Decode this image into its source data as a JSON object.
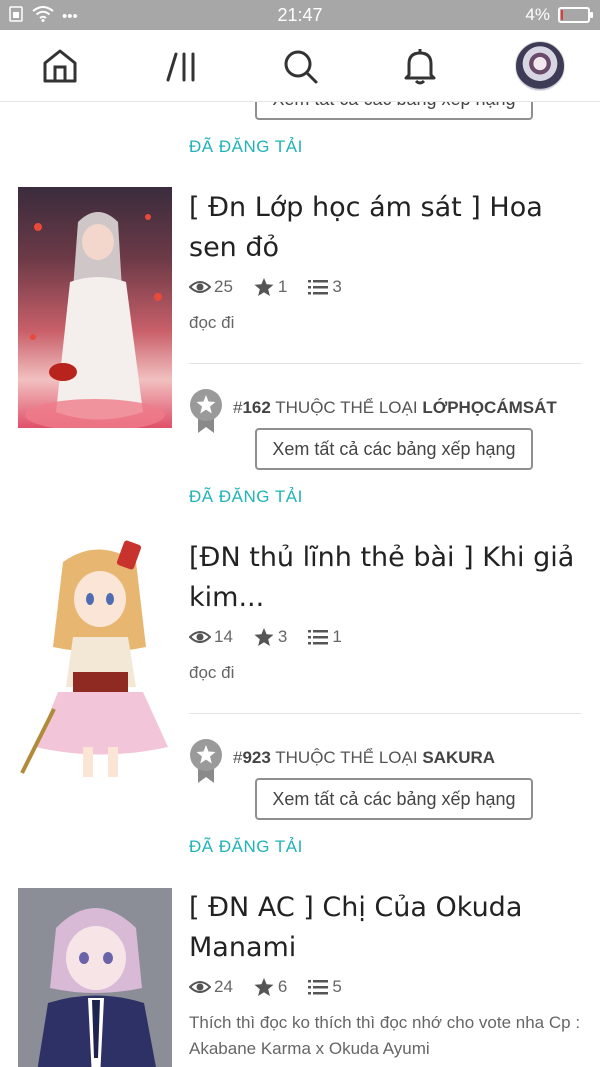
{
  "status_bar": {
    "time": "21:47",
    "battery_text": "4%",
    "battery_level_percent": 4,
    "signal_glyph": "⚀",
    "more_glyph": "•••"
  },
  "nav": {
    "home_icon": "home-icon",
    "library_icon": "library-icon",
    "search_icon": "search-icon",
    "notifications_icon": "bell-icon"
  },
  "feed": {
    "top_partial_button": "Xem tất cả các bảng xếp hạng",
    "posted_label": "ĐÃ ĐĂNG TẢI",
    "see_all_label": "Xem tất cả các bảng xếp hạng",
    "rank_prefix": "#",
    "rank_middle": "THUỘC THỂ LOẠI",
    "stories": [
      {
        "title": "[ Đn Lớp học ám sát ] Hoa sen đỏ",
        "reads": "25",
        "votes": "1",
        "parts": "3",
        "description": "đọc đi",
        "rank": "162",
        "category": "LỚPHỌCÁMSÁT"
      },
      {
        "title": "[ĐN thủ lĩnh thẻ bài ] Khi giả kim...",
        "reads": "14",
        "votes": "3",
        "parts": "1",
        "description": "đọc đi",
        "rank": "923",
        "category": "SAKURA"
      },
      {
        "title": "[ ĐN AC ] Chị Của Okuda Manami",
        "reads": "24",
        "votes": "6",
        "parts": "5",
        "description": "Thích thì đọc ko thích thì đọc nhớ cho vote nha Cp : Akabane Karma x Okuda Ayumi"
      }
    ]
  },
  "colors": {
    "accent_teal": "#21b3b9",
    "status_bar": "#a7a7a7",
    "battery_low": "#e53935"
  }
}
